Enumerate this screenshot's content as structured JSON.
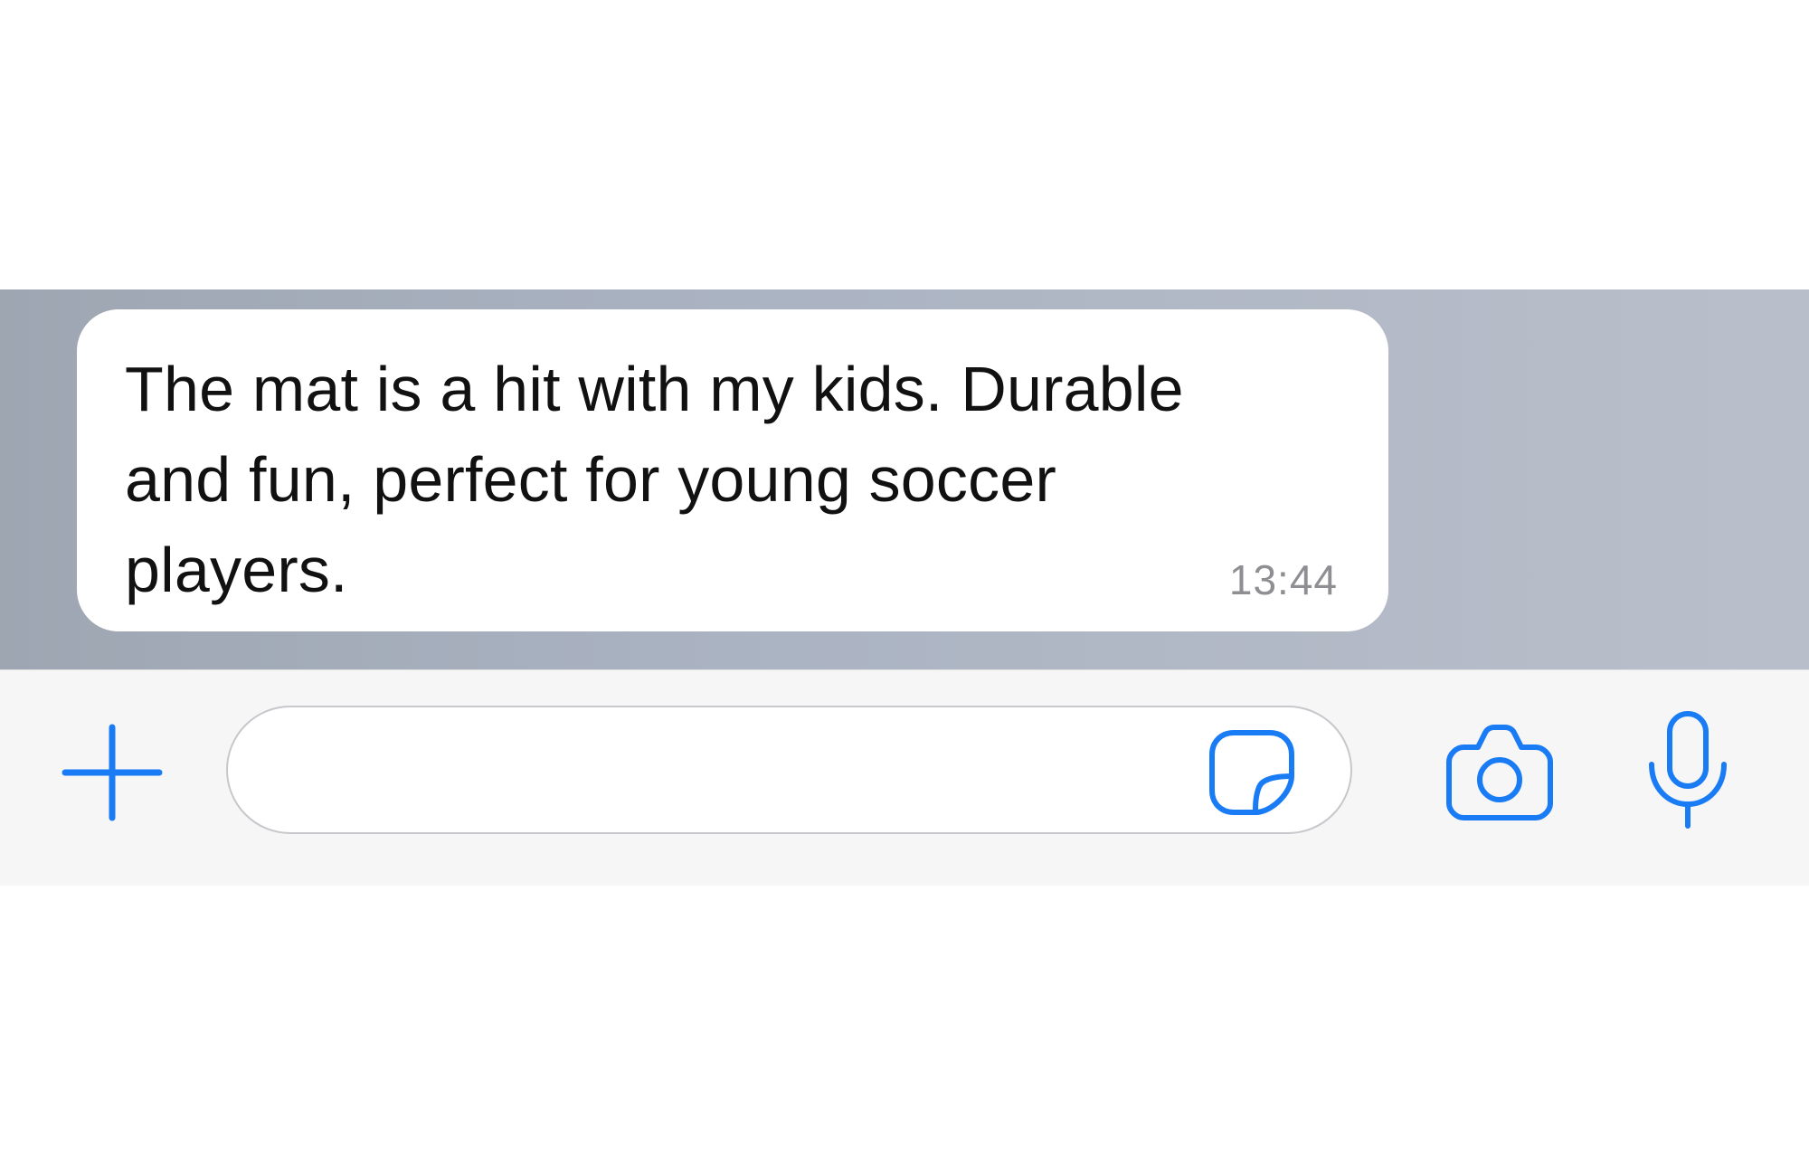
{
  "conversation": {
    "messages": [
      {
        "text": "The mat is a hit with my kids. Durable\nand fun, perfect for young soccer\nplayers.",
        "time": "13:44",
        "direction": "incoming"
      }
    ]
  },
  "composer": {
    "input_value": "",
    "input_placeholder": "",
    "icons": {
      "add": "plus-icon",
      "sticker": "sticker-icon",
      "camera": "camera-icon",
      "microphone": "microphone-icon"
    }
  },
  "colors": {
    "accent": "#1a7cf5",
    "bubble": "#ffffff",
    "timestamp": "#8e8e93",
    "input_bar": "#f6f6f6"
  }
}
